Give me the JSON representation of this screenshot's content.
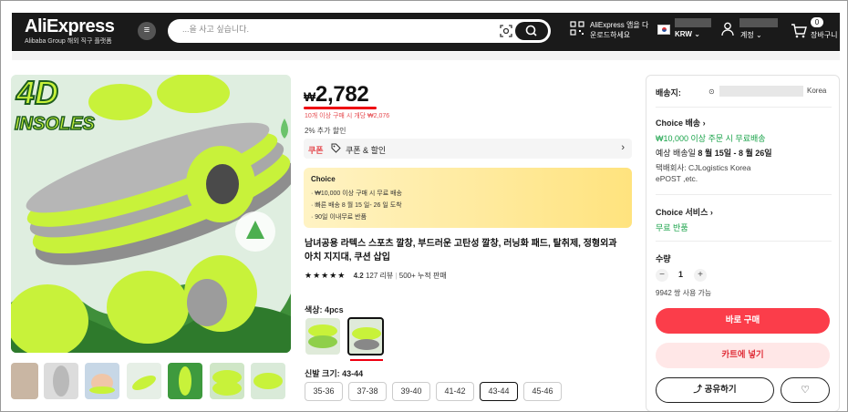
{
  "header": {
    "logo": "AliExpress",
    "logo_sub": "Alibaba Group 해외 직구 플랫폼",
    "search_placeholder": "...을 사고 싶습니다.",
    "app_line1": "AliExpress 앱을 다",
    "app_line2": "운로드하세요",
    "currency": "KRW",
    "account": "계정",
    "cart_count": "0",
    "cart_label": "장바구니"
  },
  "product": {
    "price_symbol": "₩",
    "price_value": "2,782",
    "price_sub": "10개 이상 구매 시 개당 ₩2,076",
    "discount": "2% 추가 할인",
    "coupon_tag": "쿠폰",
    "coupon_text": "쿠폰 & 할인",
    "choice": {
      "title": "Choice",
      "lines": [
        "· ₩10,000 이상 구매 시 무료 배송",
        "· 빠른 배송 8 월 15 일- 26 일 도착",
        "· 90일 이내무료 반품"
      ]
    },
    "title_line1": "남녀공용 라텍스 스포츠 깔창, 부드러운 고탄성 깔창, 러닝화 패드, 탈취제, 정형외과",
    "title_line2": "아치 지지대, 쿠션 삽입",
    "stars": "★★★★★",
    "rating": "4.2",
    "reviews": "127 리뷰",
    "sold": "500+ 누적 판매",
    "color_label": "색상: 4pcs",
    "size_label": "신발 크기: 43-44",
    "sizes": [
      "35-36",
      "37-38",
      "39-40",
      "41-42",
      "43-44",
      "45-46"
    ],
    "image_text_line1": "4D",
    "image_text_line2": "INSOLES"
  },
  "panel": {
    "ship_label": "배송지:",
    "country": "Korea",
    "choice_ship_title": "Choice 배송",
    "free_ship": "₩10,000 이상 주문 시 무료배송",
    "est_label": "예상 배송일",
    "est_dates": "8 월 15일 - 8 월 26일",
    "courier_line1": "택배회사: CJLogistics Korea",
    "courier_line2": "ePOST ,etc.",
    "service_title": "Choice 서비스",
    "free_return": "무료 반품",
    "qty_label": "수량",
    "qty": "1",
    "available": "9942 쌍 사용 가능",
    "buy": "바로 구매",
    "add_cart": "카트에 넣기",
    "share": "공유하기"
  },
  "colors": {
    "accent_red": "#fb3d4a",
    "green": "#1aa34a",
    "header_bg": "#1a1a1a",
    "insole_green": "#c8f23a"
  }
}
